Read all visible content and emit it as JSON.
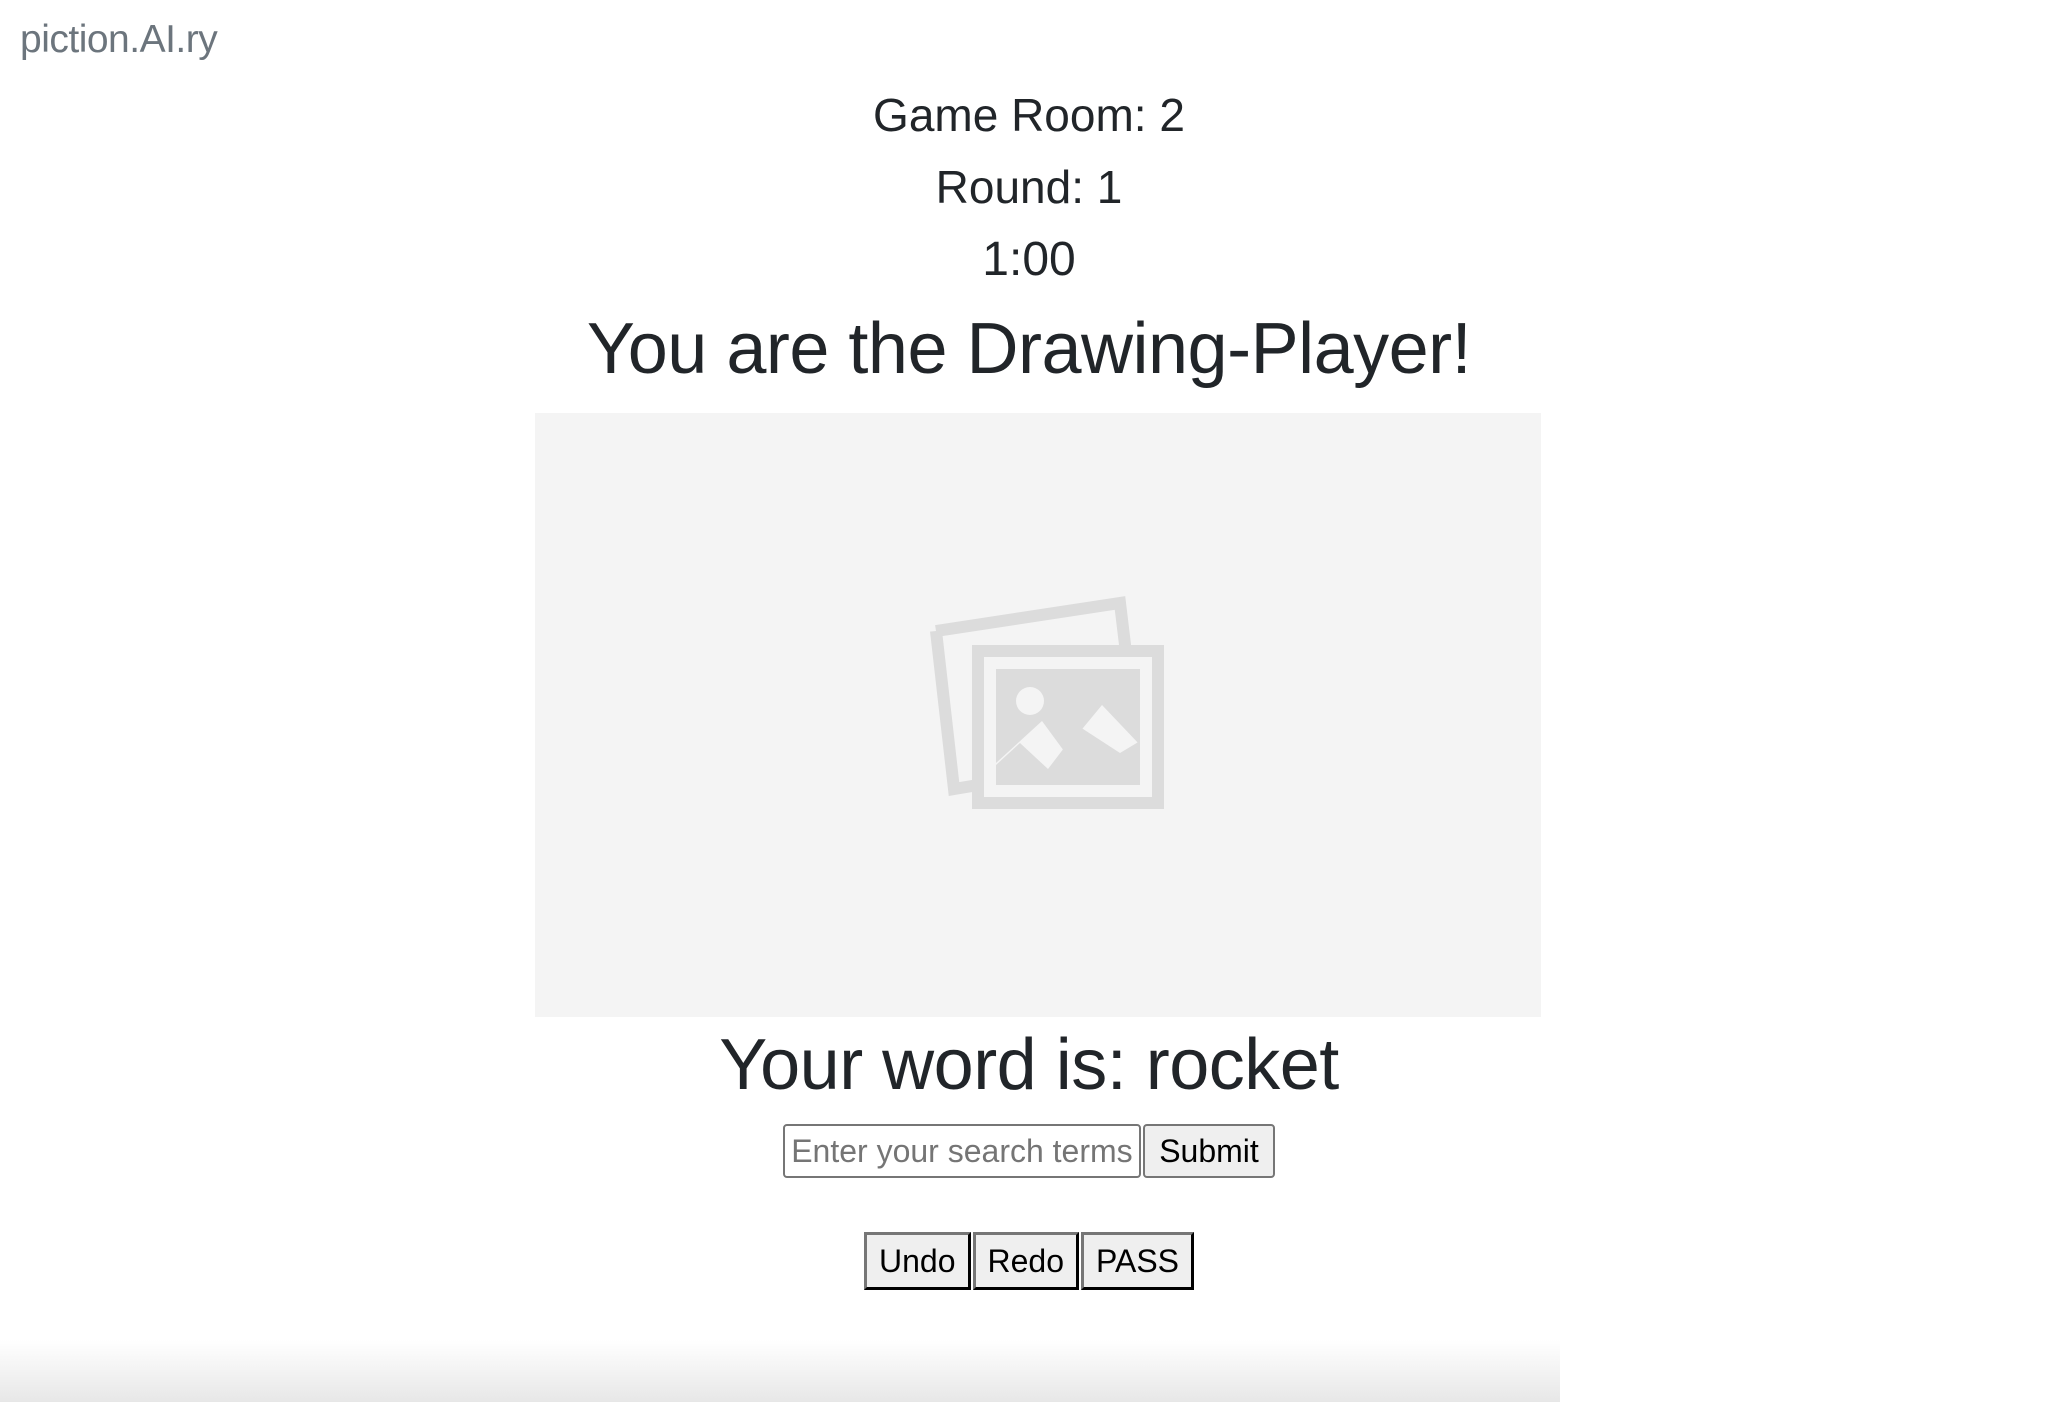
{
  "brand": "piction.AI.ry",
  "game": {
    "room_label": "Game Room: 2",
    "round_label": "Round: 1",
    "timer": "1:00",
    "role_heading": "You are the Drawing-Player!"
  },
  "canvas": {
    "placeholder_icon": "image-placeholder-icon"
  },
  "word": {
    "label": "Your word is: rocket"
  },
  "search": {
    "placeholder": "Enter your search terms",
    "value": "",
    "submit_label": "Submit"
  },
  "tools": {
    "undo_label": "Undo",
    "redo_label": "Redo",
    "pass_label": "PASS"
  }
}
